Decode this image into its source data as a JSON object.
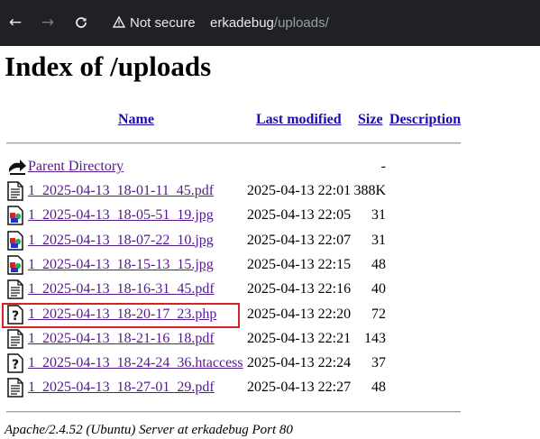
{
  "browser": {
    "security_label": "Not secure",
    "url_host": "erkadebug",
    "url_path": "/uploads/"
  },
  "page": {
    "title": "Index of /uploads",
    "columns": {
      "name": "Name",
      "last_modified": "Last modified",
      "size": "Size",
      "description": "Description"
    },
    "parent": {
      "name": "Parent Directory",
      "size": "-"
    },
    "files": [
      {
        "name": "1_2025-04-13_18-01-11_45.pdf",
        "modified": "2025-04-13 22:01",
        "size": "388K",
        "icon": "text-file-icon"
      },
      {
        "name": "1_2025-04-13_18-05-51_19.jpg",
        "modified": "2025-04-13 22:05",
        "size": "31",
        "icon": "image-file-icon"
      },
      {
        "name": "1_2025-04-13_18-07-22_10.jpg",
        "modified": "2025-04-13 22:07",
        "size": "31",
        "icon": "image-file-icon"
      },
      {
        "name": "1_2025-04-13_18-15-13_15.jpg",
        "modified": "2025-04-13 22:15",
        "size": "48",
        "icon": "image-file-icon"
      },
      {
        "name": "1_2025-04-13_18-16-31_45.pdf",
        "modified": "2025-04-13 22:16",
        "size": "40",
        "icon": "text-file-icon"
      },
      {
        "name": "1_2025-04-13_18-20-17_23.php",
        "modified": "2025-04-13 22:20",
        "size": "72",
        "icon": "unknown-file-icon"
      },
      {
        "name": "1_2025-04-13_18-21-16_18.pdf",
        "modified": "2025-04-13 22:21",
        "size": "143",
        "icon": "text-file-icon"
      },
      {
        "name": "1_2025-04-13_18-24-24_36.htaccess",
        "modified": "2025-04-13 22:24",
        "size": "37",
        "icon": "unknown-file-icon"
      },
      {
        "name": "1_2025-04-13_18-27-01_29.pdf",
        "modified": "2025-04-13 22:27",
        "size": "48",
        "icon": "text-file-icon"
      }
    ],
    "footer": "Apache/2.4.52 (Ubuntu) Server at erkadebug Port 80"
  },
  "colors": {
    "link": "#1a0dab",
    "visited": "#551a8b",
    "highlight": "#d62222",
    "chrome_bg": "#202124"
  }
}
